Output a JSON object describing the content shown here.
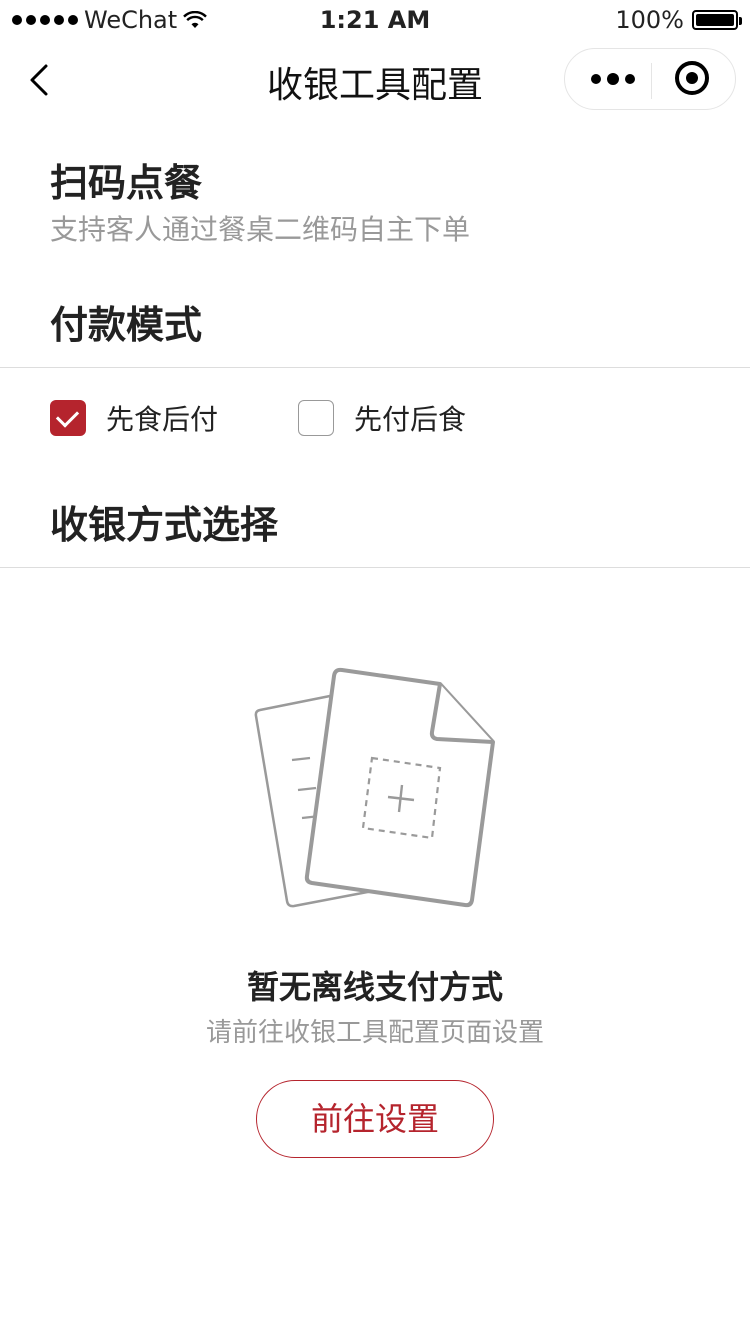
{
  "status_bar": {
    "carrier": "WeChat",
    "time": "1:21 AM",
    "battery": "100%"
  },
  "nav": {
    "title": "收银工具配置"
  },
  "scan_order": {
    "title": "扫码点餐",
    "subtitle": "支持客人通过餐桌二维码自主下单"
  },
  "payment_mode": {
    "title": "付款模式",
    "options": [
      {
        "label": "先食后付",
        "checked": true
      },
      {
        "label": "先付后食",
        "checked": false
      }
    ]
  },
  "cashier_method": {
    "title": "收银方式选择"
  },
  "empty_state": {
    "title": "暂无离线支付方式",
    "subtitle": "请前往收银工具配置页面设置",
    "button_label": "前往设置"
  },
  "colors": {
    "accent": "#b5242d",
    "muted_text": "#999999",
    "divider": "#dddddd"
  }
}
